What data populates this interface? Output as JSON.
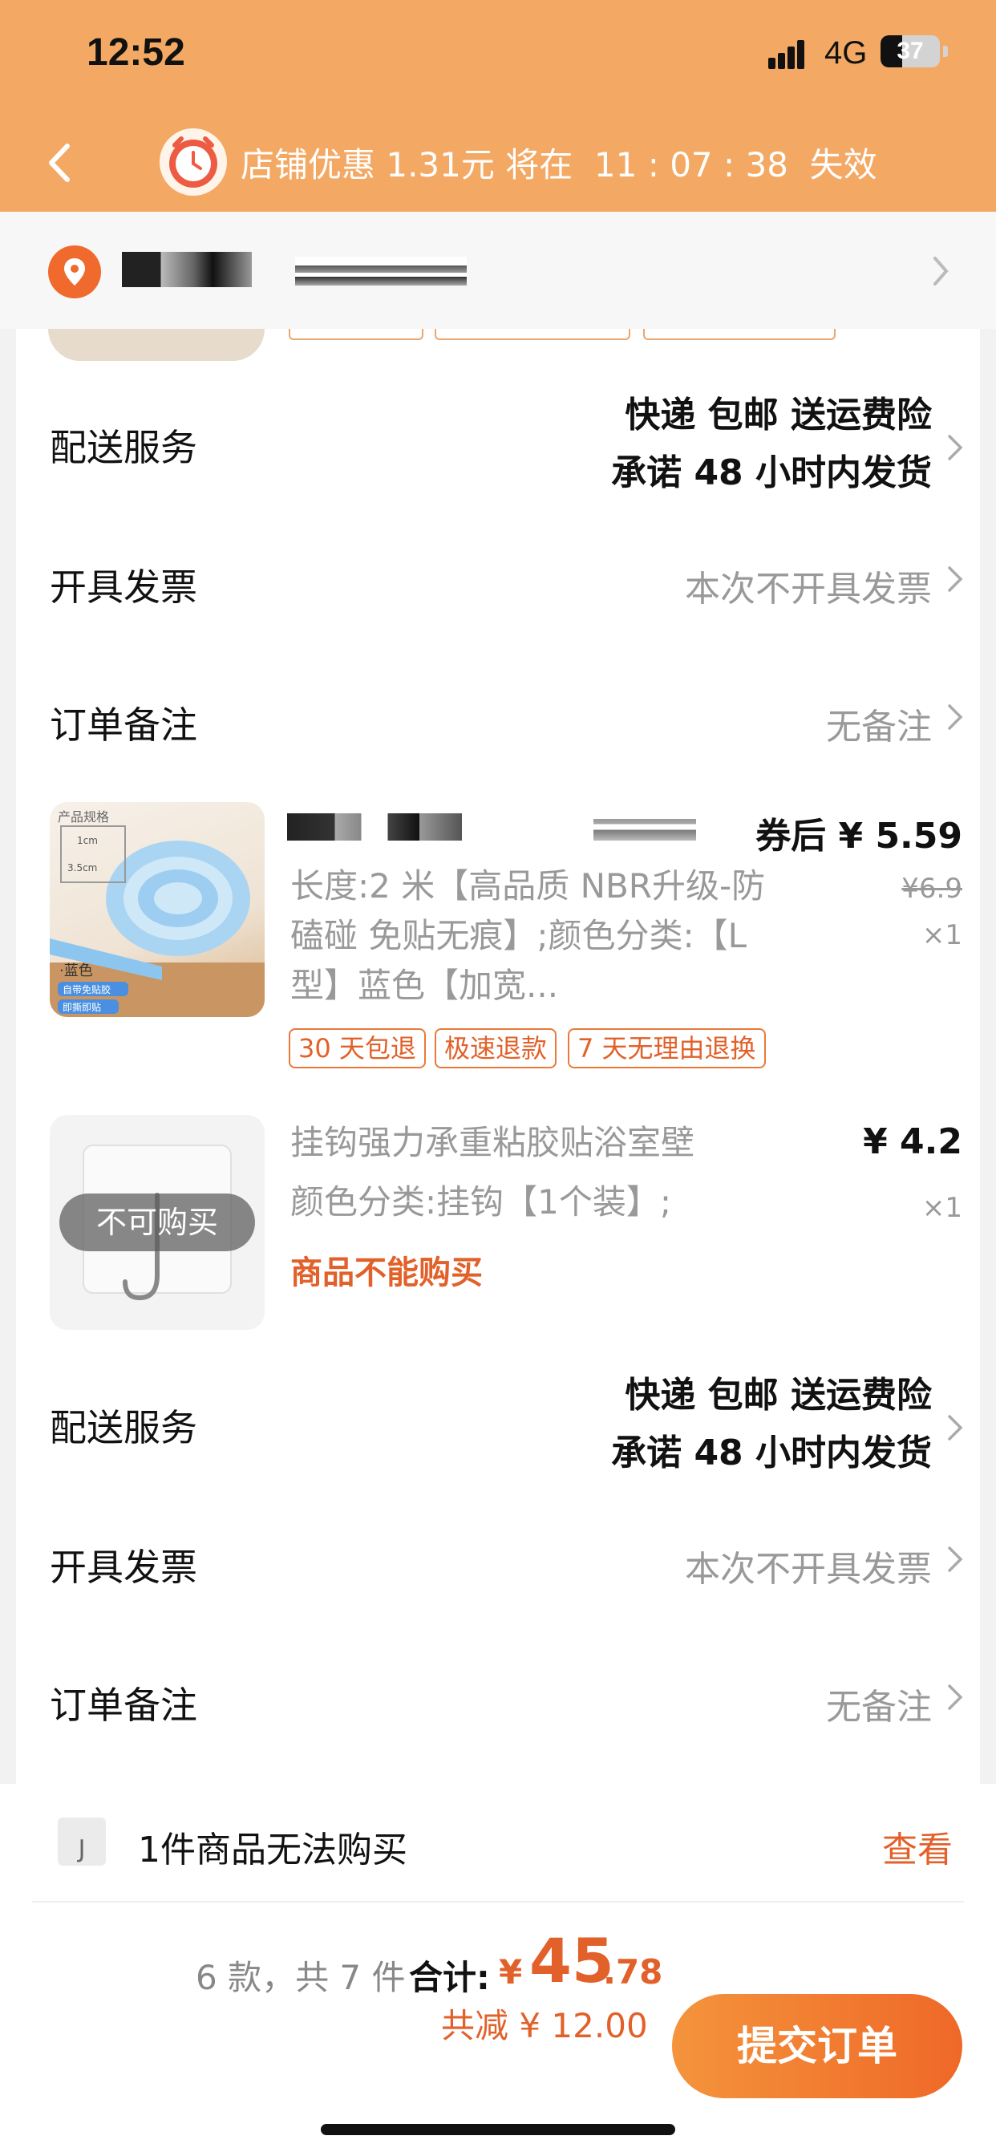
{
  "status_bar": {
    "time": "12:52",
    "network": "4G",
    "battery": "37",
    "battery_fraction": 0.37
  },
  "nav": {
    "promo_text": "店铺优惠 1.31元 将在  11 : 07 : 38  失效"
  },
  "shipping_1": {
    "label": "配送服务",
    "line1": "快递 包邮 送运费险",
    "line2": "承诺 48 小时内发货"
  },
  "invoice_1": {
    "label": "开具发票",
    "value": "本次不开具发票"
  },
  "note_1": {
    "label": "订单备注",
    "value": "无备注"
  },
  "product_1": {
    "price": "券后 ¥ 5.59",
    "old_price": "¥6.9",
    "qty": "×1",
    "desc": "长度:2 米【高品质 NBR升级-防磕碰  免贴无痕】;颜色分类:【L 型】蓝色【加宽...",
    "img_header": "产品规格",
    "img_dim1": "1cm",
    "img_dim2": "3.5cm",
    "img_color": "·蓝色",
    "img_tag1": "自带免贴胶",
    "img_tag2": "即撕即贴",
    "tags": [
      "30 天包退",
      "极速退款",
      "7 天无理由退换"
    ]
  },
  "product_2": {
    "title": "挂钩强力承重粘胶贴浴室壁",
    "spec": "颜色分类:挂钩【1个装】;",
    "price": "¥ 4.2",
    "qty": "×1",
    "unavailable_badge": "不可购买",
    "warning": "商品不能购买"
  },
  "shipping_2": {
    "label": "配送服务",
    "line1": "快递 包邮 送运费险",
    "line2": "承诺 48 小时内发货"
  },
  "invoice_2": {
    "label": "开具发票",
    "value": "本次不开具发票"
  },
  "note_2": {
    "label": "订单备注",
    "value": "无备注"
  },
  "unavailable": {
    "text": "1件商品无法购买",
    "link": "查看"
  },
  "summary": {
    "count": "6 款，共 7 件",
    "total_label": "合计:",
    "currency": "¥",
    "total_int": "45",
    "total_dec": ".78",
    "discount": "共减 ¥ 12.00",
    "submit": "提交订单"
  },
  "colors": {
    "header": "#f3a964",
    "accent": "#e2612a",
    "button_start": "#f4943c",
    "button_end": "#ef6828"
  },
  "icons": [
    "back-icon",
    "alarm-clock-icon",
    "location-pin-icon",
    "chevron-right-icon"
  ]
}
